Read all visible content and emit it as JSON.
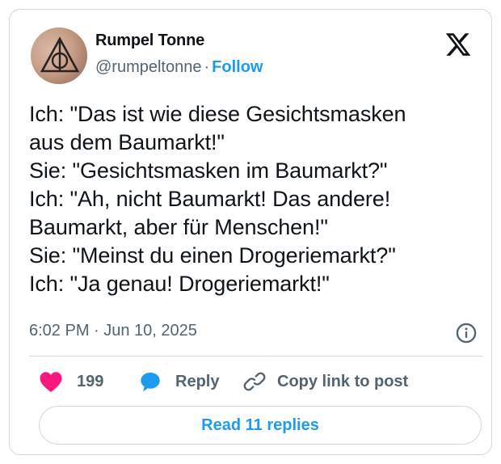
{
  "author": {
    "name": "Rumpel Tonne",
    "handle": "@rumpeltonne",
    "separator": "·",
    "follow_label": "Follow"
  },
  "post": {
    "lines": [
      "Ich: \"Das ist wie diese Gesichtsmasken",
      "aus dem Baumarkt!\"",
      "Sie: \"Gesichtsmasken im Baumarkt?\"",
      "Ich: \"Ah, nicht Baumarkt! Das andere!",
      "Baumarkt, aber für Menschen!\"",
      "Sie: \"Meinst du einen Drogeriemarkt?\"",
      "Ich: \"Ja genau! Drogeriemarkt!\""
    ],
    "timestamp": "6:02 PM · Jun 10, 2025"
  },
  "actions": {
    "like_count": "199",
    "reply_label": "Reply",
    "copy_label": "Copy link to post"
  },
  "read_replies_label": "Read 11 replies",
  "icons": {
    "platform": "x-logo-icon",
    "like": "heart-icon",
    "reply": "speech-bubble-icon",
    "copy": "link-icon",
    "info": "info-icon"
  },
  "colors": {
    "accent": "#1d9bf0",
    "like": "#f91880",
    "secondary_text": "#536471",
    "border": "#cfd9de"
  }
}
